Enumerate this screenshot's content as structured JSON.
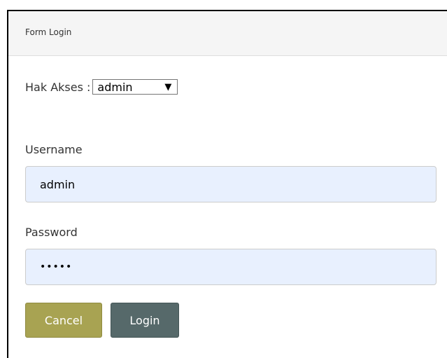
{
  "panel": {
    "title": "Form Login"
  },
  "access": {
    "label": "Hak Akses :",
    "selected": "admin",
    "arrow": "▼"
  },
  "form": {
    "username_label": "Username",
    "username_value": "admin",
    "password_label": "Password",
    "password_value": "•••••"
  },
  "buttons": {
    "cancel": "Cancel",
    "login": "Login"
  },
  "colors": {
    "cancel_button": "#a8a352",
    "login_button": "#56696a",
    "input_background": "#e8f0fe"
  }
}
